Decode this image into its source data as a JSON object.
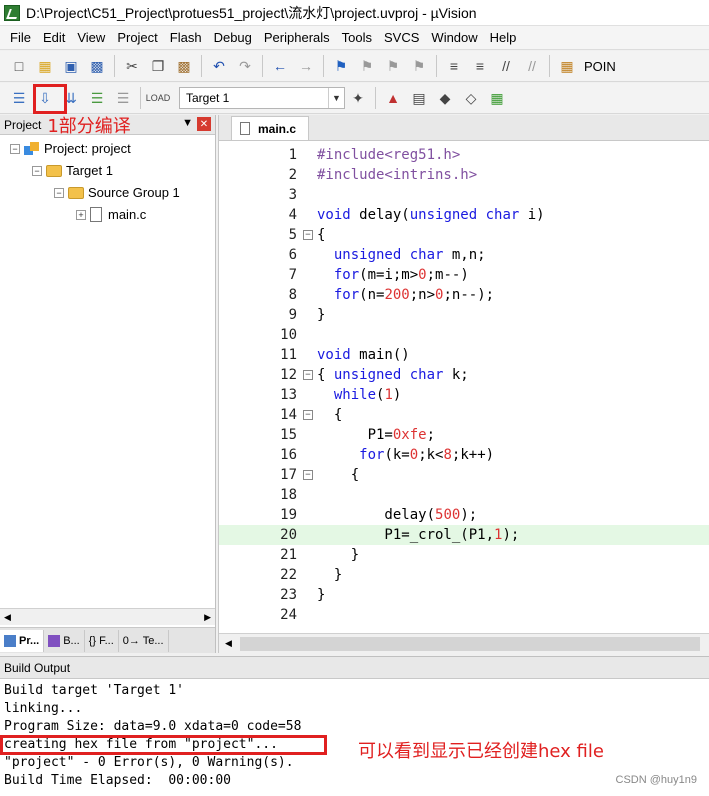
{
  "window": {
    "title": "D:\\Project\\C51_Project\\protues51_project\\流水灯\\project.uvproj - µVision"
  },
  "menubar": {
    "items": [
      "File",
      "Edit",
      "View",
      "Project",
      "Flash",
      "Debug",
      "Peripherals",
      "Tools",
      "SVCS",
      "Window",
      "Help"
    ]
  },
  "toolbar1": {
    "poin_label": "POIN"
  },
  "toolbar2": {
    "target_value": "Target 1"
  },
  "project_pane": {
    "title": "Project",
    "annotation": "1部分编译",
    "tree": {
      "project": "Project: project",
      "target": "Target 1",
      "group": "Source Group 1",
      "file": "main.c"
    },
    "tabs": [
      "Pr...",
      "B...",
      "{} F...",
      "0→ Te..."
    ]
  },
  "editor": {
    "tab": "main.c",
    "line_numbers": [
      "1",
      "2",
      "3",
      "4",
      "5",
      "6",
      "7",
      "8",
      "9",
      "10",
      "11",
      "12",
      "13",
      "14",
      "15",
      "16",
      "17",
      "18",
      "19",
      "20",
      "21",
      "22",
      "23",
      "24"
    ],
    "current_line": 20
  },
  "build_output": {
    "title": "Build Output",
    "lines": [
      "Build target 'Target 1'",
      "linking...",
      "Program Size: data=9.0 xdata=0 code=58",
      "creating hex file from \"project\"...",
      "\"project\" - 0 Error(s), 0 Warning(s).",
      "Build Time Elapsed:  00:00:00"
    ],
    "annotation": "可以看到显示已经创建hex file"
  },
  "watermark": "CSDN @huy1n9",
  "colors": {
    "annotation": "#e02020",
    "keyword": "#1a1ae0",
    "number": "#d33333",
    "preprocessor": "#8050a0",
    "current_line_bg": "#e4f8e4"
  }
}
